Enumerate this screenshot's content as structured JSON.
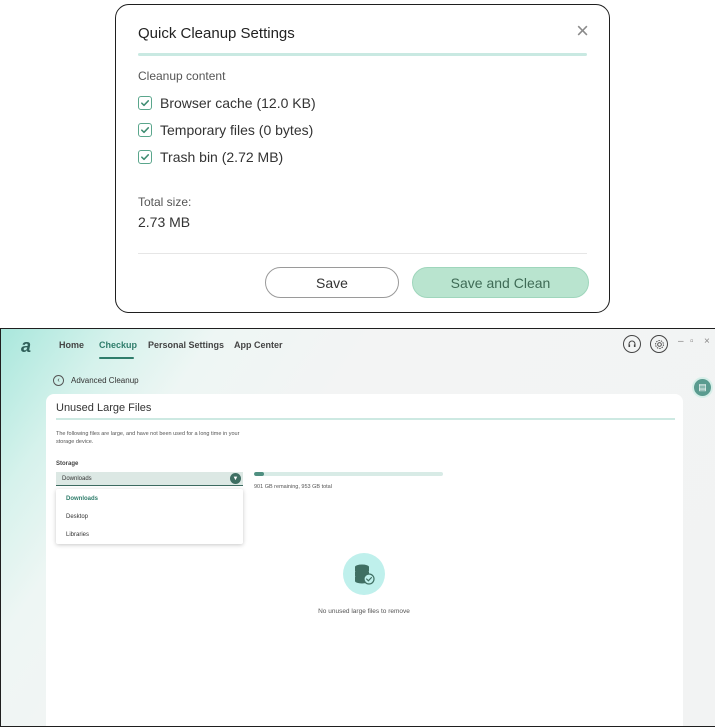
{
  "dialog": {
    "title": "Quick Cleanup Settings",
    "section_label": "Cleanup content",
    "items": [
      {
        "label": "Browser cache (12.0 KB)",
        "checked": true
      },
      {
        "label": "Temporary files (0 bytes)",
        "checked": true
      },
      {
        "label": "Trash bin (2.72 MB)",
        "checked": true
      }
    ],
    "total_label": "Total size:",
    "total_value": "2.73 MB",
    "save_label": "Save",
    "save_clean_label": "Save and Clean",
    "close_glyph": "×"
  },
  "app": {
    "logo": "a",
    "nav": [
      "Home",
      "Checkup",
      "Personal Settings",
      "App Center"
    ],
    "active_nav": "Checkup",
    "window_controls": [
      "–",
      "▫",
      "×"
    ],
    "back_label": "Advanced Cleanup",
    "card": {
      "title": "Unused Large Files",
      "description": "The following files are large, and have not been used for a long time in your storage device.",
      "storage_label": "Storage",
      "selected_storage": "Downloads",
      "options": [
        "Downloads",
        "Desktop",
        "Libraries"
      ],
      "storage_used_fraction": 0.054,
      "storage_text": "901 GB remaining, 953 GB total",
      "empty_message": "No unused large files to remove"
    }
  },
  "colors": {
    "accent": "#2f7d6b",
    "accent_light": "#b9e4cf",
    "icon_bg": "#bff0ec"
  }
}
